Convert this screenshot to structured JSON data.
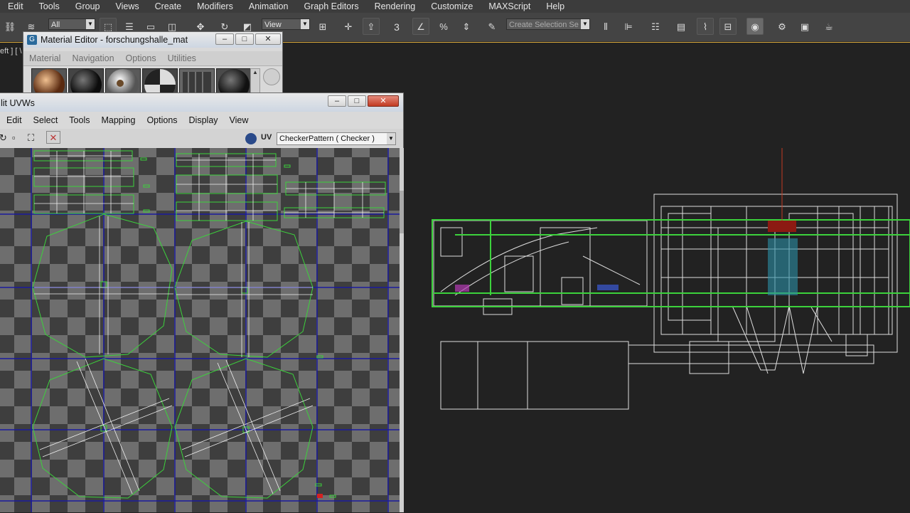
{
  "menubar": {
    "items": [
      "Edit",
      "Tools",
      "Group",
      "Views",
      "Create",
      "Modifiers",
      "Animation",
      "Graph Editors",
      "Rendering",
      "Customize",
      "MAXScript",
      "Help"
    ]
  },
  "toolbar": {
    "selection_filter": "All",
    "reference_coordinate": "View",
    "snap_toggle_label": "3",
    "named_selection_placeholder": "Create Selection Se"
  },
  "viewport": {
    "label": "eft ] [ \\"
  },
  "material_editor": {
    "title": "Material Editor - forschungshalle_mat",
    "menu": [
      "Material",
      "Navigation",
      "Options",
      "Utilities"
    ]
  },
  "uv_editor": {
    "title": "lit UVWs",
    "menu": [
      "Edit",
      "Select",
      "Tools",
      "Mapping",
      "Options",
      "Display",
      "View"
    ],
    "uv_label": "UV",
    "texture_selector": "CheckerPattern  ( Checker )"
  },
  "colors": {
    "uv_grid": "#1a1a9e",
    "uv_shell": "#3cd23c",
    "wire": "#ffffff",
    "active_border": "#d7a63a"
  }
}
